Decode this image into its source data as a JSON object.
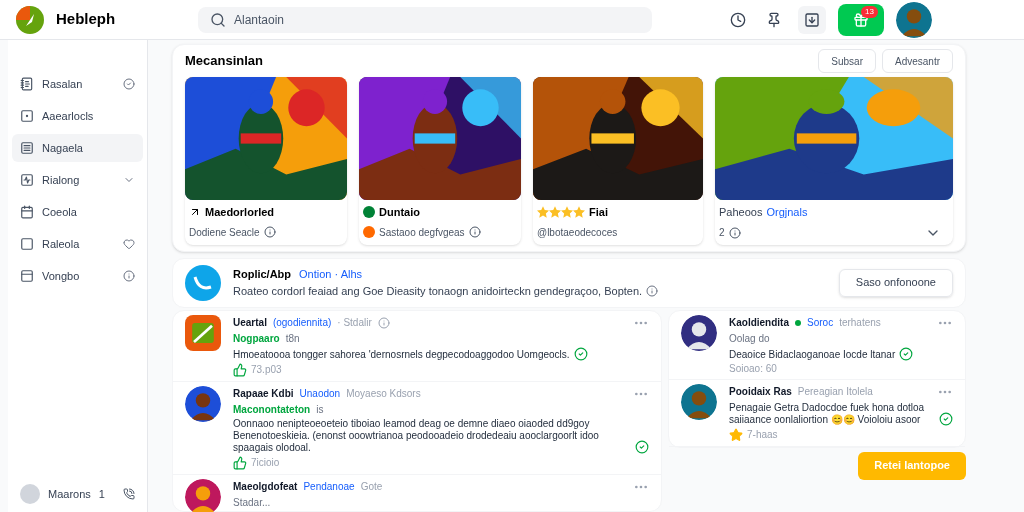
{
  "header": {
    "app_name": "Hebleph",
    "search": {
      "placeholder": "Alantaoin"
    },
    "badge": "13"
  },
  "sidebar": {
    "items": [
      {
        "label": "Rasalan",
        "selected": false
      },
      {
        "label": "Aaearlocls",
        "selected": false
      },
      {
        "label": "Nagaela",
        "selected": true
      },
      {
        "label": "Rialong",
        "selected": false
      },
      {
        "label": "Coeola",
        "selected": false
      },
      {
        "label": "Raleola",
        "selected": false
      },
      {
        "label": "Vongbo",
        "selected": false
      }
    ],
    "user": {
      "name": "Maarons",
      "mark": "1"
    }
  },
  "featured": {
    "title": "Mecansinlan",
    "buttons": [
      "Subsar",
      "Advesantr"
    ],
    "games": [
      {
        "title": "Maedorlorled",
        "subtitle": "Dodiene Seacle"
      },
      {
        "title": "Duntaio",
        "subtitle": "Sastaoo degfvgeas"
      },
      {
        "title": "Fiai",
        "stars": 4,
        "subtitle": "@lbotaeodecoces"
      },
      {
        "title": "Paheoos",
        "link": "Orgjnals",
        "subtitle": "2"
      }
    ]
  },
  "promo": {
    "title": "Roplic/Abp",
    "link": "Ontion · Alhs",
    "text": "Roateo cordorl feaiad ang Goe Dieasity tonaogn anidoirteckn gendegraçoo, Bopten.",
    "button": "Saso onfonoone"
  },
  "feed_left": [
    {
      "name": "Ueartal",
      "tag": "(ogodiennita)",
      "meta": "· Stdalir",
      "status": "Nogpaaro",
      "status_extra": "t8n",
      "body": "Hmoeatoooa tongger sahorea 'dernosrnels degpecodoaggodoo Uomgeocls.",
      "count": "73.p03"
    },
    {
      "name": "Rapaae Kdbi",
      "tag": "Unaodon",
      "meta": "Moyaeso Kdsors",
      "status": "Maconontateton",
      "status_extra": "is",
      "body": "Oonnaoo nenipteoeoeteio tiboiao leamod deag oe demne diaeo oiaoded dd9goy Benenotoeskieia. (enonst ooowtrianoa peodooadeio drodedeaiu aooclargoorlt idoo spaagais olodoal.",
      "count": "7icioio"
    },
    {
      "name": "Maeolgdofeat",
      "tag": "Pendanoae",
      "meta": "Gote",
      "status_extra": "Stadar..."
    }
  ],
  "feed_right": [
    {
      "name": "Kaoldiendita",
      "tag": "Soroc",
      "meta": "terhatens",
      "status_extra": "Oolag do",
      "body": "Deaoice Bidaclaoganoae Iocde ltanar",
      "count": "Soioao: 60"
    },
    {
      "name": "Pooidaix Ras",
      "meta": "Pereagian Itolela",
      "body": "Penagaie Getra Dadocdoe fuek hona dotloa saiiaance oonlaliortion 😊😊 Voioloiu asoor",
      "count": "7-haas"
    }
  ],
  "cta_button": "Retei Iantopoe"
}
